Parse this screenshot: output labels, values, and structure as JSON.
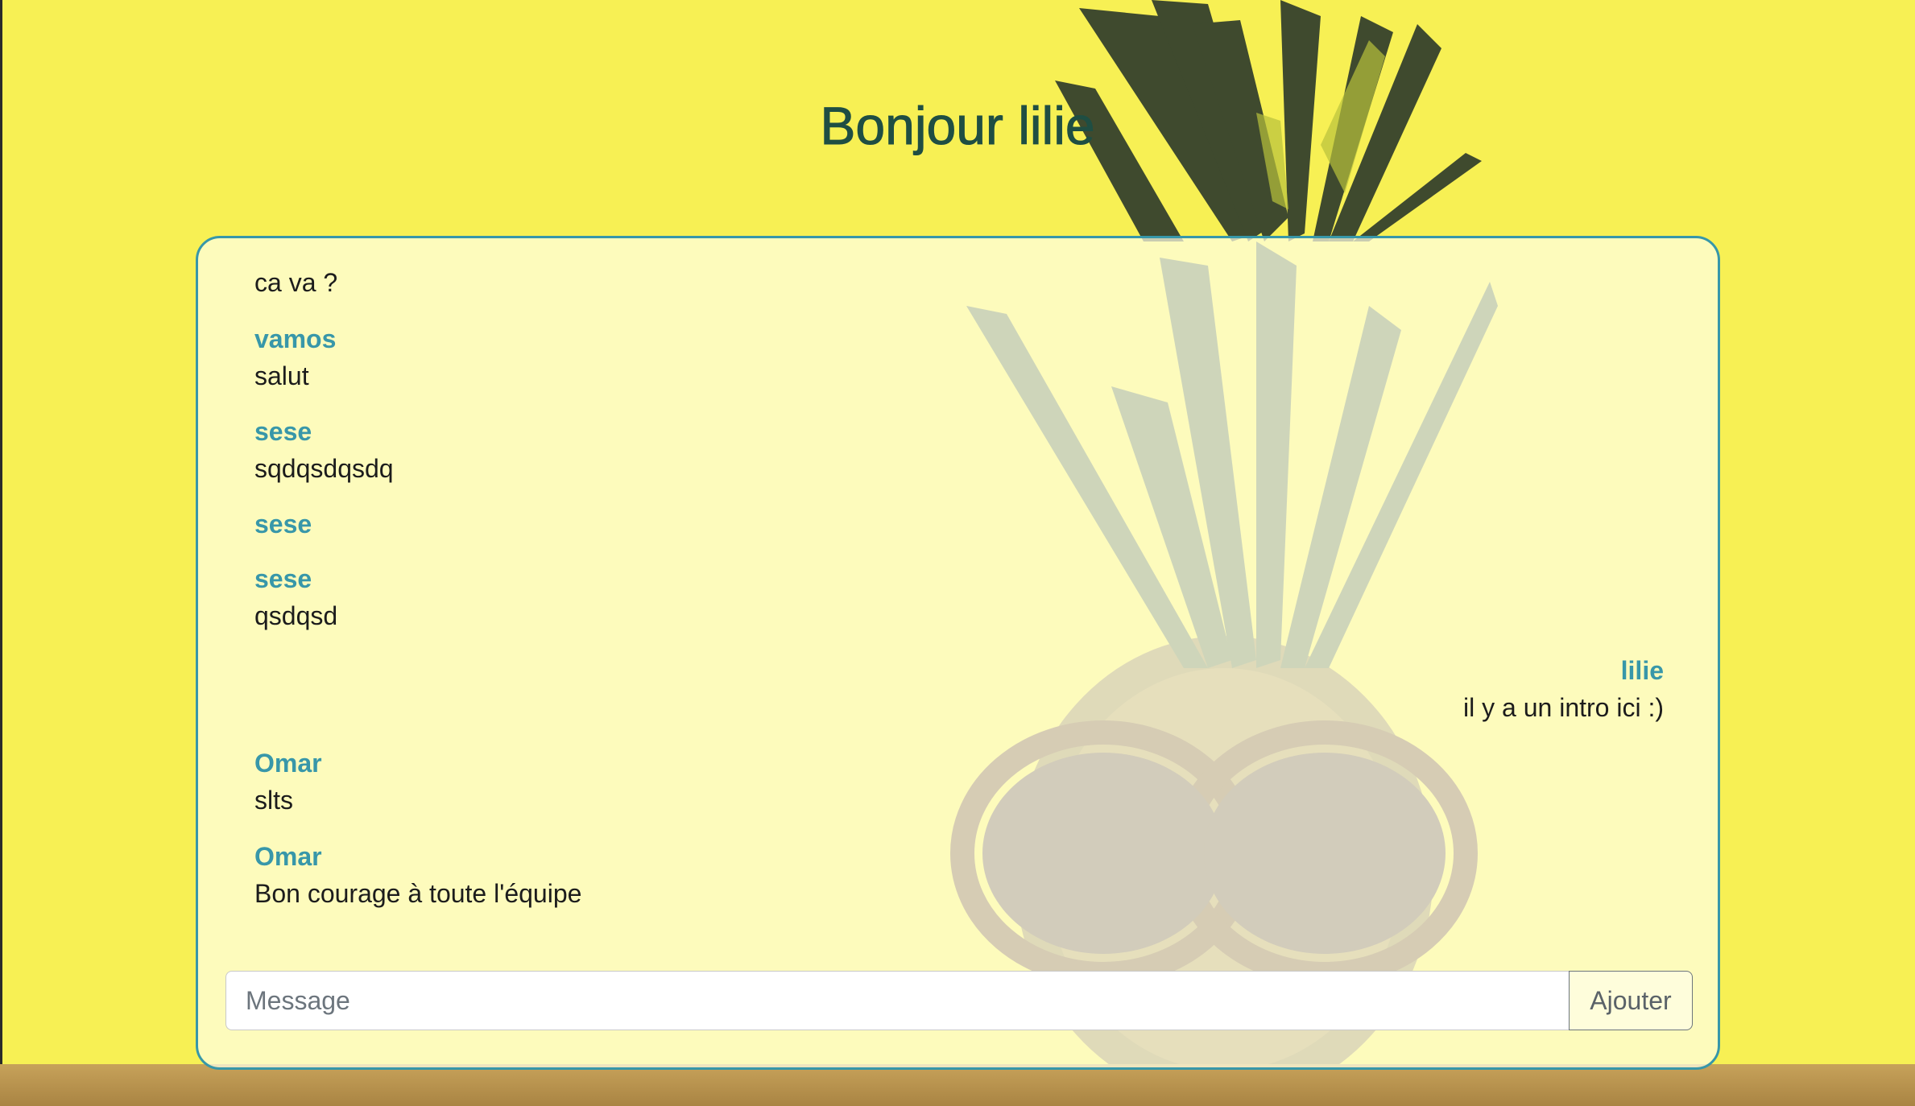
{
  "header": {
    "title": "Bonjour lilie"
  },
  "messages": [
    {
      "author": "vamos",
      "text": "ca va ?",
      "own": false
    },
    {
      "author": "vamos",
      "text": "salut",
      "own": false
    },
    {
      "author": "sese",
      "text": "sqdqsdqsdq",
      "own": false
    },
    {
      "author": "sese",
      "text": "",
      "own": false
    },
    {
      "author": "sese",
      "text": "qsdqsd",
      "own": false
    },
    {
      "author": "lilie",
      "text": "il y a un intro ici :)",
      "own": true
    },
    {
      "author": "Omar",
      "text": "slts",
      "own": false
    },
    {
      "author": "Omar",
      "text": "Bon courage à toute l'équipe",
      "own": false
    }
  ],
  "composer": {
    "placeholder": "Message",
    "value": "",
    "send_label": "Ajouter"
  },
  "colors": {
    "background": "#f7f054",
    "accent": "#3797a9",
    "title": "#1f4e43"
  }
}
